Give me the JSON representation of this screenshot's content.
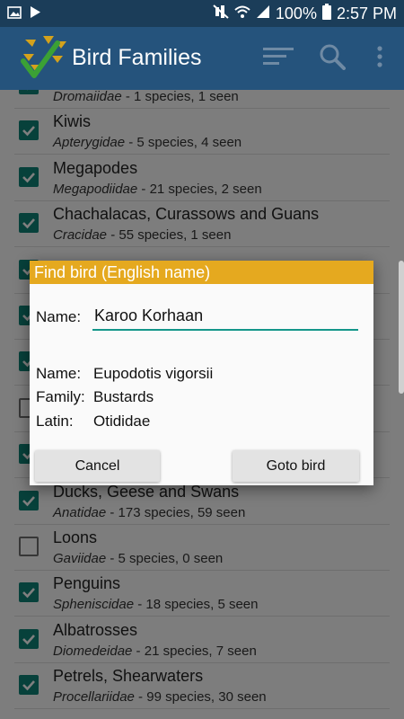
{
  "status_bar": {
    "battery": "100%",
    "time": "2:57 PM",
    "icons": [
      "image-icon",
      "play-store-icon",
      "mute-icon",
      "wifi-icon",
      "signal-icon",
      "battery-icon"
    ]
  },
  "app_bar": {
    "title": "Bird Families",
    "actions": [
      "sort-icon",
      "search-icon",
      "overflow-menu-icon"
    ]
  },
  "colors": {
    "status_bar": "#1b3d59",
    "app_bar": "#25537c",
    "checkbox": "#0e8376",
    "dialog_header": "#e5a91f",
    "input_underline": "#13968a"
  },
  "list": {
    "items": [
      {
        "name": "",
        "latin": "Dromaiidae",
        "stats": " - 1 species, 1 seen",
        "checked": true
      },
      {
        "name": "Kiwis",
        "latin": "Apterygidae",
        "stats": " - 5 species, 4 seen",
        "checked": true
      },
      {
        "name": "Megapodes",
        "latin": "Megapodiidae",
        "stats": " - 21 species, 2 seen",
        "checked": true
      },
      {
        "name": "Chachalacas, Curassows and Guans",
        "latin": "Cracidae",
        "stats": " - 55 species, 1 seen",
        "checked": true
      },
      {
        "name": "",
        "latin": "",
        "stats": "",
        "checked": true
      },
      {
        "name": "",
        "latin": "",
        "stats": "",
        "checked": true
      },
      {
        "name": "",
        "latin": "",
        "stats": "",
        "checked": true
      },
      {
        "name": "",
        "latin": "",
        "stats": "",
        "checked": false
      },
      {
        "name": "",
        "latin": "",
        "stats": "",
        "checked": true
      },
      {
        "name": "Ducks, Geese and Swans",
        "latin": "Anatidae",
        "stats": " - 173 species, 59 seen",
        "checked": true
      },
      {
        "name": "Loons",
        "latin": "Gaviidae",
        "stats": " - 5 species, 0 seen",
        "checked": false
      },
      {
        "name": "Penguins",
        "latin": "Spheniscidae",
        "stats": " - 18 species, 5 seen",
        "checked": true
      },
      {
        "name": "Albatrosses",
        "latin": "Diomedeidae",
        "stats": " - 21 species, 7 seen",
        "checked": true
      },
      {
        "name": "Petrels, Shearwaters",
        "latin": "Procellariidae",
        "stats": " - 99 species, 30 seen",
        "checked": true
      }
    ]
  },
  "dialog": {
    "title": "Find bird (English name)",
    "name_label": "Name:",
    "name_value": "Karoo Korhaan",
    "result": {
      "name_label": "Name:",
      "name_value": "Eupodotis vigorsii",
      "family_label": "Family:",
      "family_value": "Bustards",
      "latin_label": "Latin:",
      "latin_value": "Otididae"
    },
    "cancel_label": "Cancel",
    "goto_label": "Goto bird"
  }
}
